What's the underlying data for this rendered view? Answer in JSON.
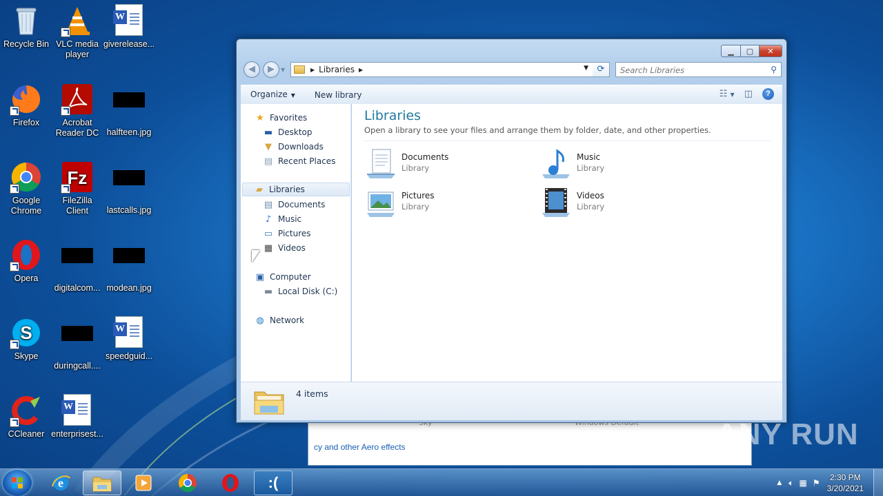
{
  "desktop": {
    "icons": [
      {
        "label": "Recycle Bin",
        "icon": "recycle-bin-icon"
      },
      {
        "label": "VLC media player",
        "icon": "vlc-icon"
      },
      {
        "label": "giverelease...",
        "icon": "word-document-icon"
      },
      {
        "label": "Firefox",
        "icon": "firefox-icon"
      },
      {
        "label": "Acrobat Reader DC",
        "icon": "acrobat-icon"
      },
      {
        "label": "halfteen.jpg",
        "icon": "image-file-icon"
      },
      {
        "label": "Google Chrome",
        "icon": "chrome-icon"
      },
      {
        "label": "FileZilla Client",
        "icon": "filezilla-icon"
      },
      {
        "label": "lastcalls.jpg",
        "icon": "image-file-icon"
      },
      {
        "label": "Opera",
        "icon": "opera-icon"
      },
      {
        "label": "digitalcom...",
        "icon": "image-file-icon"
      },
      {
        "label": "modean.jpg",
        "icon": "image-file-icon"
      },
      {
        "label": "Skype",
        "icon": "skype-icon"
      },
      {
        "label": "duringcall....",
        "icon": "image-file-icon"
      },
      {
        "label": "speedguid...",
        "icon": "word-document-icon"
      },
      {
        "label": "CCleaner",
        "icon": "ccleaner-icon"
      },
      {
        "label": "enterprisest...",
        "icon": "word-document-icon"
      }
    ]
  },
  "background_window": {
    "link": "cy and other Aero effects",
    "faint_left": "Sky",
    "faint_right": "Windows Default"
  },
  "explorer": {
    "address": {
      "crumb": "Libraries"
    },
    "search": {
      "placeholder": "Search Libraries"
    },
    "toolbar": {
      "organize": "Organize",
      "new_library": "New library"
    },
    "nav": {
      "favorites": "Favorites",
      "desktop": "Desktop",
      "downloads": "Downloads",
      "recent_places": "Recent Places",
      "libraries": "Libraries",
      "documents": "Documents",
      "music": "Music",
      "pictures": "Pictures",
      "videos": "Videos",
      "computer": "Computer",
      "local_disk": "Local Disk (C:)",
      "network": "Network"
    },
    "content": {
      "title": "Libraries",
      "subtitle": "Open a library to see your files and arrange them by folder, date, and other properties.",
      "libraries": [
        {
          "name": "Documents",
          "type": "Library"
        },
        {
          "name": "Music",
          "type": "Library"
        },
        {
          "name": "Pictures",
          "type": "Library"
        },
        {
          "name": "Videos",
          "type": "Library"
        }
      ]
    },
    "status": {
      "count": "4 items"
    }
  },
  "taskbar": {
    "apps": [
      "internet-explorer-icon",
      "windows-explorer-icon",
      "media-player-icon",
      "chrome-icon",
      "opera-icon",
      "sad-face-app-icon"
    ],
    "clock": {
      "time": "2:30 PM",
      "date": "3/20/2021"
    }
  },
  "watermark": "ANY RUN",
  "colors": {
    "title_accent": "#1f7a9d",
    "close_button": "#c84530",
    "link": "#1a5fb4"
  }
}
